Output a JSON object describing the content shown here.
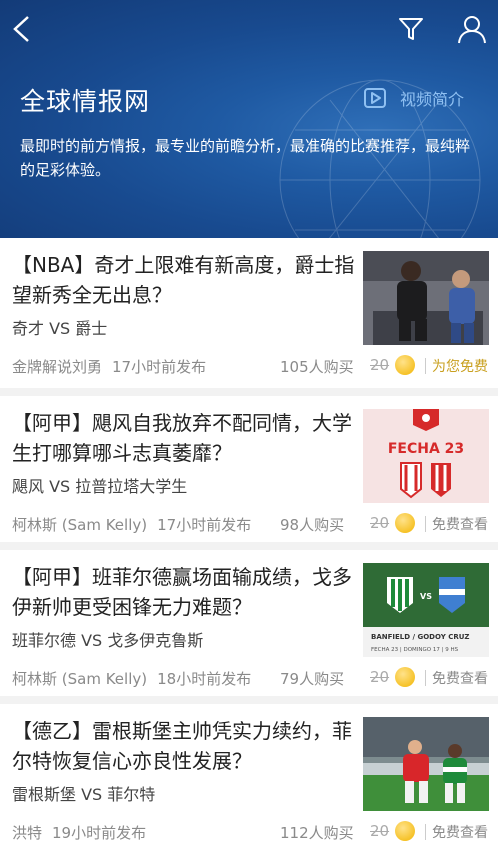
{
  "header": {
    "title": "全球情报网",
    "video_label": "视频简介",
    "description": "最即时的前方情报，最专业的前瞻分析，最准确的比赛推荐，最纯粹的足彩体验。"
  },
  "colors": {
    "header_bg": "#184a8f",
    "accent_gold": "#f2b500",
    "link_blue": "#8fc0f2"
  },
  "articles": [
    {
      "title": "【NBA】奇才上限难有新高度，爵士指望新秀全无出息？",
      "teams": "奇才 VS 爵士",
      "author": "金牌解说刘勇",
      "time": "17小时前发布",
      "buyers": "105人购买",
      "price": "20",
      "tag": "为您免费",
      "thumb": "basketball-photo"
    },
    {
      "title": "【阿甲】飓风自我放弃不配同情，大学生打哪算哪斗志真萎靡？",
      "teams": "飓风 VS 拉普拉塔大学生",
      "author": "柯林斯 (Sam Kelly)",
      "time": "17小时前发布",
      "buyers": "98人购买",
      "price": "20",
      "tag": "免费查看",
      "thumb_text": "FECHA 23"
    },
    {
      "title": "【阿甲】班菲尔德赢场面输成绩，戈多伊新帅更受困锋无力难题？",
      "teams": "班菲尔德 VS 戈多伊克鲁斯",
      "author": "柯林斯 (Sam Kelly)",
      "time": "18小时前发布",
      "buyers": "79人购买",
      "price": "20",
      "tag": "免费查看",
      "thumb_text": "BANFIELD / GODOY CRUZ",
      "thumb_sub": "FECHA 23 | DOMINGO 17 | 9 HS"
    },
    {
      "title": "【德乙】雷根斯堡主帅凭实力续约，菲尔特恢复信心亦良性发展？",
      "teams": "雷根斯堡 VS 菲尔特",
      "author": "洪特",
      "time": "19小时前发布",
      "buyers": "112人购买",
      "price": "20",
      "tag": "免费查看",
      "thumb": "soccer-photo"
    }
  ]
}
